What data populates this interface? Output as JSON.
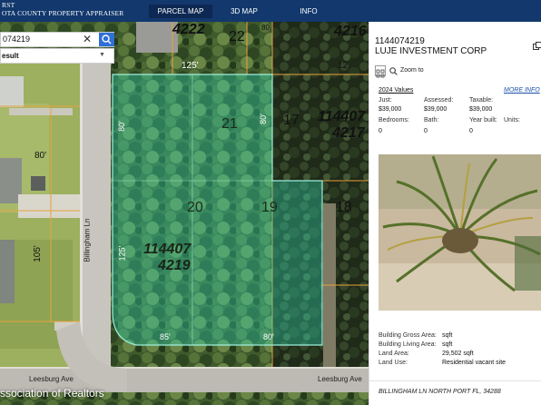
{
  "header": {
    "brand_line1": "RST",
    "brand_line2": "OTA COUNTY PROPERTY APPRAISER",
    "nav": [
      {
        "label": "PARCEL MAP",
        "active": true
      },
      {
        "label": "3D MAP",
        "active": false
      },
      {
        "label": "INFO",
        "active": false
      }
    ],
    "bar_color": "#12386d"
  },
  "search": {
    "value": "074219",
    "result_label": "esult"
  },
  "map": {
    "labels": {
      "lot_top_a": "4222",
      "lot_top_b": "22",
      "lot_top_c": "4216",
      "dim_125_top": "125'",
      "dim_125_right": "12",
      "lot_21": "21",
      "dim_80_a": "80'",
      "dim_80_b": "80'",
      "lot_17": "17",
      "lot_right_id": "114407",
      "lot_right_id2": "4217",
      "lot_20": "20",
      "lot_19": "19",
      "lot_18": "18",
      "parcel_id_1": "114407",
      "parcel_id_2": "4219",
      "dim_125_left": "125'",
      "dim_85": "85'",
      "dim_80_bottom": "80'",
      "dim_80_left": "80'",
      "dim_105": "105'",
      "street_v": "Billingham Ln",
      "street_h1": "Leesburg Ave",
      "street_h2": "Leesburg Ave",
      "top_dim_partial": "80"
    },
    "highlight_color": "#2fd6b0",
    "parcel_line_color": "#e8a33d"
  },
  "watermark": "ssociation of Realtors",
  "panel": {
    "parcel_id": "1144074219",
    "owner": "LUJE INVESTMENT CORP",
    "zoom_label": "Zoom to",
    "values_title": "2024 Values",
    "more_info": "MORE INFO",
    "values": {
      "just_label": "Just:",
      "just": "$39,000",
      "assessed_label": "Assessed:",
      "assessed": "$39,000",
      "taxable_label": "Taxable:",
      "taxable": "$39,000",
      "bedrooms_label": "Bedrooms:",
      "bedrooms": "0",
      "bath_label": "Bath:",
      "bath": "0",
      "year_built_label": "Year built:",
      "year_built": "0",
      "units_label": "Units:",
      "units": ""
    },
    "details": {
      "gross_area_label": "Building Gross Area:",
      "gross_area": "sqft",
      "living_area_label": "Building Living Area:",
      "living_area": "sqft",
      "land_area_label": "Land Area:",
      "land_area": "29,502 sqft",
      "land_use_label": "Land Use:",
      "land_use": "Residential vacant site"
    },
    "address": "BILLINGHAM LN NORTH PORT FL, 34288"
  }
}
